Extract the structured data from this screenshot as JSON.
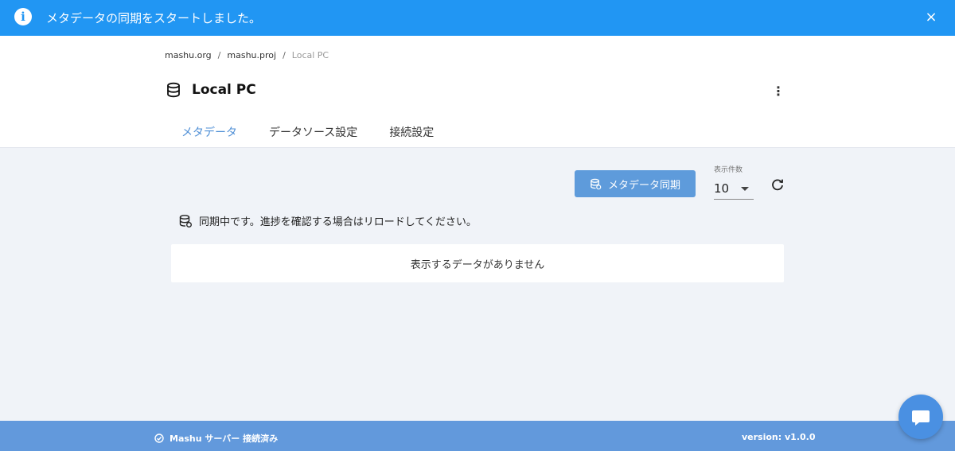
{
  "banner": {
    "message": "メタデータの同期をスタートしました。",
    "info_glyph": "i",
    "close_glyph": "×",
    "color": "#2196f3"
  },
  "breadcrumb": {
    "items": [
      "mashu.org",
      "mashu.proj",
      "Local PC"
    ],
    "separator": "/"
  },
  "page": {
    "title": "Local PC",
    "more_glyph": "⋮"
  },
  "tabs": [
    {
      "label": "メタデータ",
      "active": true
    },
    {
      "label": "データソース設定",
      "active": false
    },
    {
      "label": "接続設定",
      "active": false
    }
  ],
  "toolbar": {
    "sync_label": "メタデータ同期",
    "count_label": "表示件数",
    "count_value": "10"
  },
  "content": {
    "syncing_message": "同期中です。進捗を確認する場合はリロードしてください。",
    "empty_message": "表示するデータがありません"
  },
  "footer": {
    "status": "Mashu サーバー 接続済み",
    "version": "version: v1.0.0",
    "color": "#6299dc"
  },
  "icons": {
    "banner": "info-icon",
    "close": "close-icon",
    "title": "database-icon",
    "more": "kebab-menu-icon",
    "sync": "database-sync-icon",
    "refresh": "refresh-icon",
    "status": "check-circle-icon",
    "chat": "chat-icon"
  },
  "accent_color": "#4f8fd6"
}
